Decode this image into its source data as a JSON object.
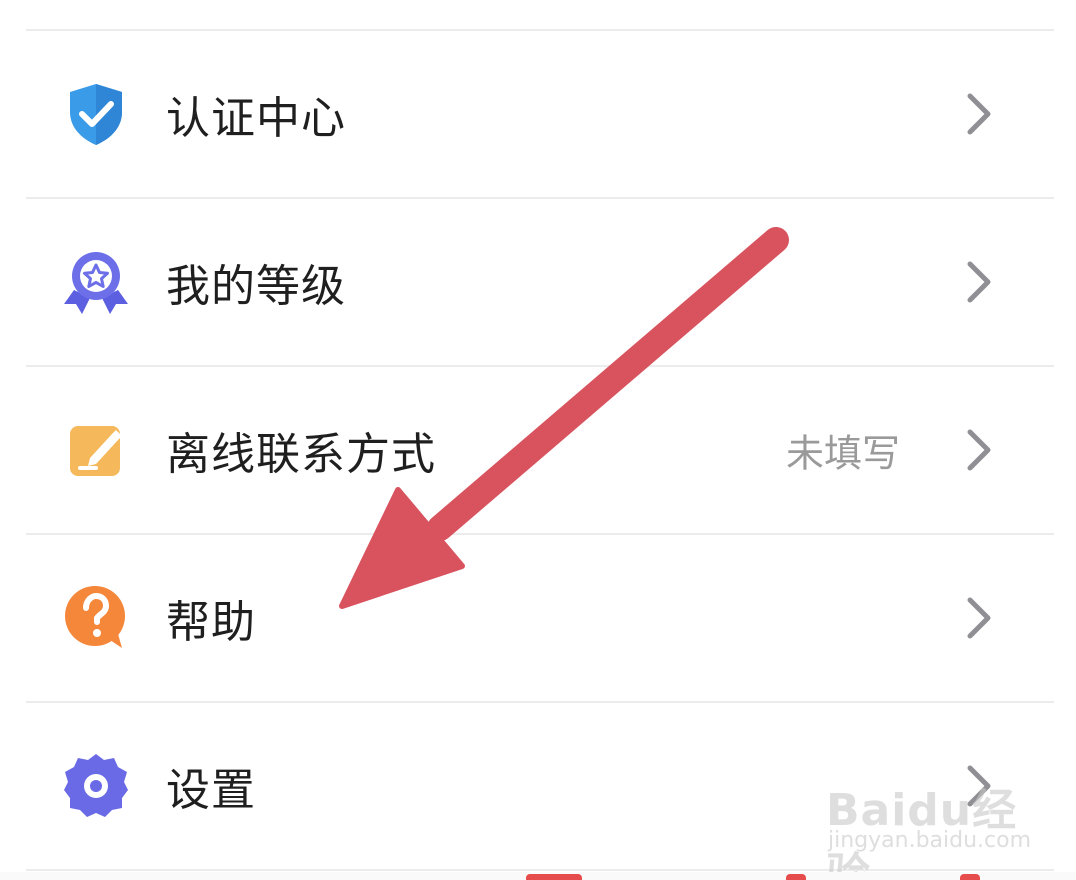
{
  "menu": {
    "items": [
      {
        "label": "认证中心",
        "value": "",
        "icon": "shield-check-icon"
      },
      {
        "label": "我的等级",
        "value": "",
        "icon": "medal-star-icon"
      },
      {
        "label": "离线联系方式",
        "value": "未填写",
        "icon": "note-pencil-icon"
      },
      {
        "label": "帮助",
        "value": "",
        "icon": "question-bubble-icon"
      },
      {
        "label": "设置",
        "value": "",
        "icon": "gear-icon"
      }
    ]
  },
  "watermark": {
    "logo": "Baidu经验",
    "url": "jingyan.baidu.com"
  },
  "colors": {
    "shield": "#3a9be8",
    "medal": "#6d6fe8",
    "note": "#f5b85a",
    "question": "#f5873a",
    "gear": "#6a6ae6",
    "arrow": "#d9535e",
    "chevron": "#8f8f94"
  }
}
